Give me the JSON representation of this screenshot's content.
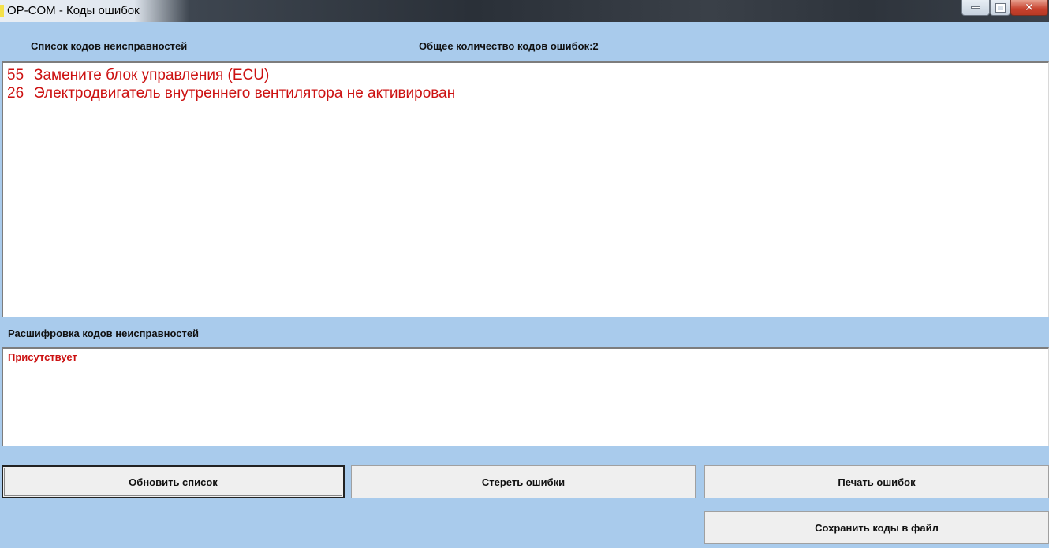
{
  "window": {
    "title": "OP-COM - Коды ошибок",
    "controls": {
      "minimize": "minimize-icon",
      "maximize": "maximize-icon",
      "close": "close-icon"
    }
  },
  "header": {
    "list_label": "Список кодов неисправностей",
    "total_label": "Общее количество кодов ошибок:2"
  },
  "codes": [
    {
      "code": "55",
      "text": "Замените блок управления (ECU)"
    },
    {
      "code": "26",
      "text": "Электродвигатель внутреннего вентилятора не активирован"
    }
  ],
  "decode": {
    "label": "Расшифровка кодов неисправностей",
    "status": "Присутствует"
  },
  "buttons": {
    "refresh": "Обновить список",
    "clear": "Стереть ошибки",
    "print": "Печать ошибок",
    "save": "Сохранить коды в файл"
  },
  "colors": {
    "background": "#a9cbec",
    "error_text": "#cc1111"
  }
}
